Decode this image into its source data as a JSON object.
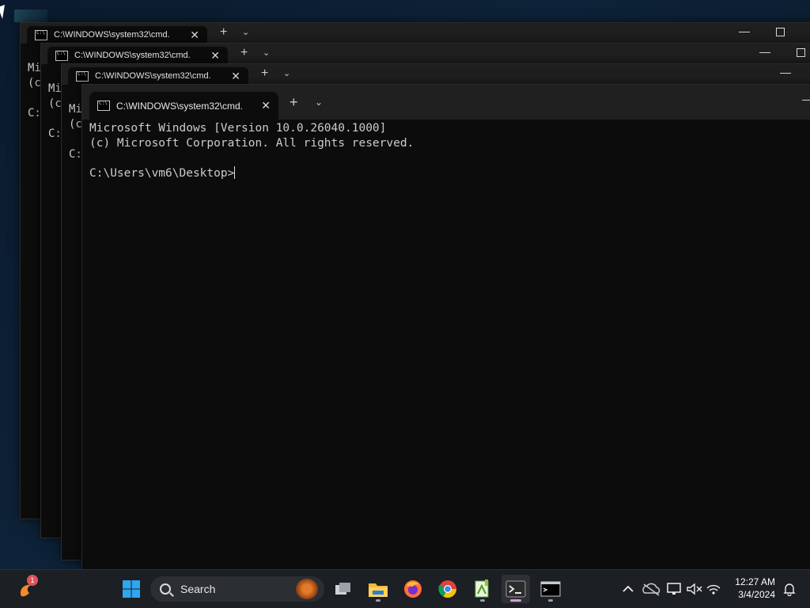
{
  "windows": [
    {
      "tab_title": "C:\\WINDOWS\\system32\\cmd.",
      "lines": [
        "Mi",
        "(c",
        "",
        "C:"
      ]
    },
    {
      "tab_title": "C:\\WINDOWS\\system32\\cmd.",
      "lines": [
        "Mi",
        "(c",
        "",
        "C:"
      ]
    },
    {
      "tab_title": "C:\\WINDOWS\\system32\\cmd.",
      "lines": [
        "Mi",
        "(c",
        "",
        "C:"
      ]
    },
    {
      "tab_title": "C:\\WINDOWS\\system32\\cmd.",
      "new_tab_label": "+",
      "dropdown_label": "⌄",
      "close_label": "✕",
      "line1": "Microsoft Windows [Version 10.0.26040.1000]",
      "line2": "(c) Microsoft Corporation. All rights reserved.",
      "prompt": "C:\\Users\\vm6\\Desktop>"
    }
  ],
  "window_controls": {
    "minimize": "—"
  },
  "taskbar": {
    "search_label": "Search",
    "widget_badge": "1",
    "clock_time": "12:27 AM",
    "clock_date": "3/4/2024",
    "icons": [
      "widgets-icon",
      "start-icon",
      "search-icon",
      "task-view-icon",
      "file-explorer-icon",
      "firefox-icon",
      "chrome-icon",
      "notepad-plus-icon",
      "terminal-icon",
      "cmd-icon",
      "tray-chevron-icon",
      "onedrive-icon",
      "network-icon",
      "volume-muted-icon",
      "wifi-icon",
      "notifications-icon"
    ]
  }
}
